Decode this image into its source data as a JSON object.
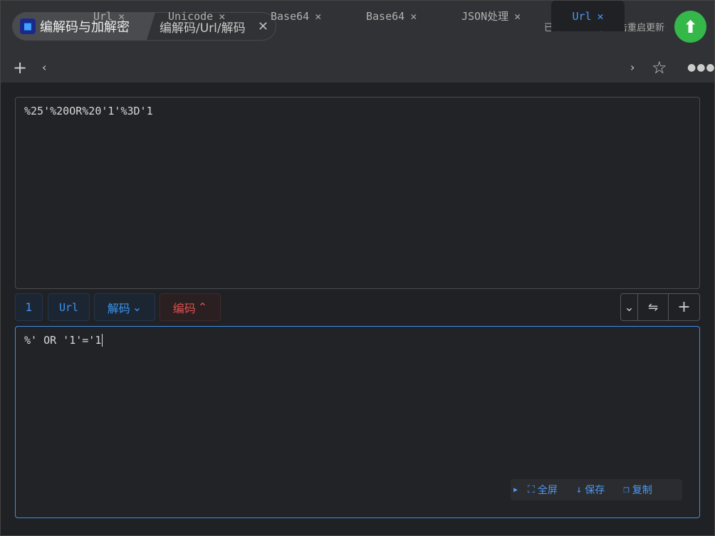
{
  "header": {
    "app_title": "编解码与加解密",
    "path": "编解码/Url/解码",
    "update_text": "已下载新版本，点击重启更新"
  },
  "tabs": [
    {
      "label": "Url"
    },
    {
      "label": "Unicode"
    },
    {
      "label": "Base64"
    },
    {
      "label": "Base64"
    },
    {
      "label": "JSON处理"
    },
    {
      "label": "Url",
      "active": true
    }
  ],
  "input": {
    "value": "%25'%20OR%20'1'%3D'1"
  },
  "toolbar": {
    "index": "1",
    "type": "Url",
    "decode": "解码",
    "encode": "编码"
  },
  "output": {
    "value": "%' OR '1'='1"
  },
  "actions": {
    "fullscreen": "全屏",
    "save": "保存",
    "copy": "复制"
  },
  "colors": {
    "accent": "#3e94ee",
    "encode": "#e05050",
    "update": "#34b84a"
  }
}
